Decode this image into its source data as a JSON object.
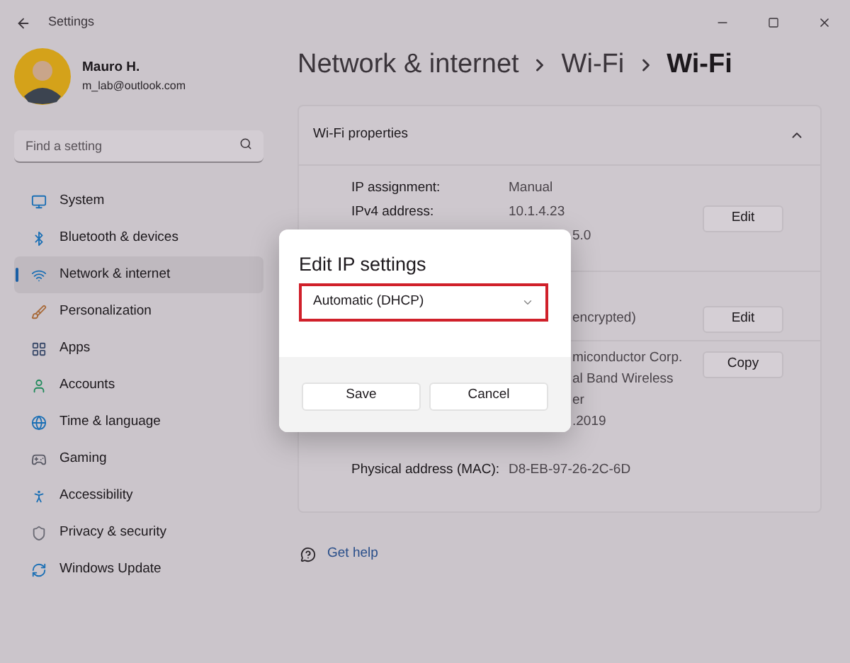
{
  "window": {
    "title": "Settings"
  },
  "user": {
    "name": "Mauro H.",
    "email": "m_lab@outlook.com"
  },
  "search": {
    "placeholder": "Find a setting"
  },
  "sidebar": {
    "items": [
      {
        "label": "System",
        "selected": false
      },
      {
        "label": "Bluetooth & devices",
        "selected": false
      },
      {
        "label": "Network & internet",
        "selected": true
      },
      {
        "label": "Personalization",
        "selected": false
      },
      {
        "label": "Apps",
        "selected": false
      },
      {
        "label": "Accounts",
        "selected": false
      },
      {
        "label": "Time & language",
        "selected": false
      },
      {
        "label": "Gaming",
        "selected": false
      },
      {
        "label": "Accessibility",
        "selected": false
      },
      {
        "label": "Privacy & security",
        "selected": false
      },
      {
        "label": "Windows Update",
        "selected": false
      }
    ]
  },
  "breadcrumb": [
    {
      "label": "Network & internet",
      "current": false
    },
    {
      "label": "Wi-Fi",
      "current": false
    },
    {
      "label": "Wi-Fi",
      "current": true
    }
  ],
  "card": {
    "title": "Wi-Fi properties",
    "expanded": true,
    "sections": [
      {
        "button": "Edit",
        "rows": [
          {
            "label": "IP assignment:",
            "value": "Manual"
          },
          {
            "label": "IPv4 address:",
            "value": "10.1.4.23"
          },
          {
            "value": "5.0"
          }
        ]
      },
      {
        "button": "Edit",
        "rows": [
          {
            "value": "encrypted)"
          }
        ]
      },
      {
        "button": "Copy",
        "rows": [
          {
            "value": "miconductor Corp."
          },
          {
            "value": "al Band Wireless"
          },
          {
            "value": "er"
          },
          {
            "value": ".2019"
          },
          {
            "label": "Physical address (MAC):",
            "value": "D8-EB-97-26-2C-6D"
          }
        ]
      }
    ]
  },
  "get_help": "Get help",
  "dialog": {
    "title": "Edit IP settings",
    "dropdown": {
      "value": "Automatic (DHCP)",
      "highlighted": true
    },
    "buttons": [
      "Save",
      "Cancel"
    ]
  }
}
